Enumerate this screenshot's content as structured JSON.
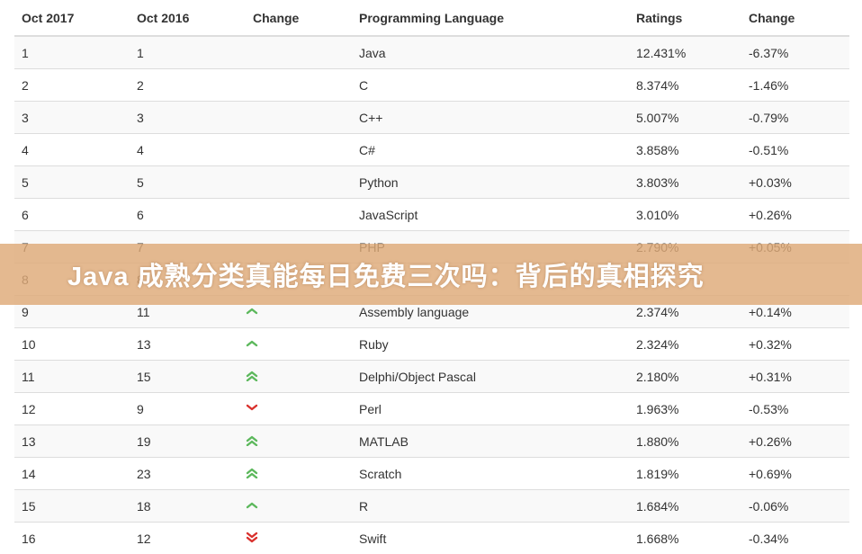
{
  "table": {
    "headers": [
      "Oct 2017",
      "Oct 2016",
      "Change",
      "Programming Language",
      "Ratings",
      "Change"
    ],
    "rows": [
      {
        "rank_2017": "1",
        "rank_2016": "1",
        "trend": "none",
        "language": "Java",
        "rating": "12.431%",
        "change": "-6.37%"
      },
      {
        "rank_2017": "2",
        "rank_2016": "2",
        "trend": "none",
        "language": "C",
        "rating": "8.374%",
        "change": "-1.46%"
      },
      {
        "rank_2017": "3",
        "rank_2016": "3",
        "trend": "none",
        "language": "C++",
        "rating": "5.007%",
        "change": "-0.79%"
      },
      {
        "rank_2017": "4",
        "rank_2016": "4",
        "trend": "none",
        "language": "C#",
        "rating": "3.858%",
        "change": "-0.51%"
      },
      {
        "rank_2017": "5",
        "rank_2016": "5",
        "trend": "none",
        "language": "Python",
        "rating": "3.803%",
        "change": "+0.03%"
      },
      {
        "rank_2017": "6",
        "rank_2016": "6",
        "trend": "none",
        "language": "JavaScript",
        "rating": "3.010%",
        "change": "+0.26%"
      },
      {
        "rank_2017": "7",
        "rank_2016": "7",
        "trend": "none",
        "language": "PHP",
        "rating": "2.790%",
        "change": "+0.05%"
      },
      {
        "rank_2017": "8",
        "rank_2016": "8",
        "trend": "none",
        "language": "",
        "rating": "",
        "change": ""
      },
      {
        "rank_2017": "9",
        "rank_2016": "11",
        "trend": "up",
        "language": "Assembly language",
        "rating": "2.374%",
        "change": "+0.14%"
      },
      {
        "rank_2017": "10",
        "rank_2016": "13",
        "trend": "up",
        "language": "Ruby",
        "rating": "2.324%",
        "change": "+0.32%"
      },
      {
        "rank_2017": "11",
        "rank_2016": "15",
        "trend": "up-double",
        "language": "Delphi/Object Pascal",
        "rating": "2.180%",
        "change": "+0.31%"
      },
      {
        "rank_2017": "12",
        "rank_2016": "9",
        "trend": "down",
        "language": "Perl",
        "rating": "1.963%",
        "change": "-0.53%"
      },
      {
        "rank_2017": "13",
        "rank_2016": "19",
        "trend": "up-double",
        "language": "MATLAB",
        "rating": "1.880%",
        "change": "+0.26%"
      },
      {
        "rank_2017": "14",
        "rank_2016": "23",
        "trend": "up-double",
        "language": "Scratch",
        "rating": "1.819%",
        "change": "+0.69%"
      },
      {
        "rank_2017": "15",
        "rank_2016": "18",
        "trend": "up",
        "language": "R",
        "rating": "1.684%",
        "change": "-0.06%"
      },
      {
        "rank_2017": "16",
        "rank_2016": "12",
        "trend": "down-double",
        "language": "Swift",
        "rating": "1.668%",
        "change": "-0.34%"
      }
    ]
  },
  "banner": {
    "text": "Java 成熟分类真能每日免费三次吗：背后的真相探究"
  },
  "colors": {
    "up": "#5cb85c",
    "down": "#d9302c",
    "banner": "#deaa78"
  }
}
